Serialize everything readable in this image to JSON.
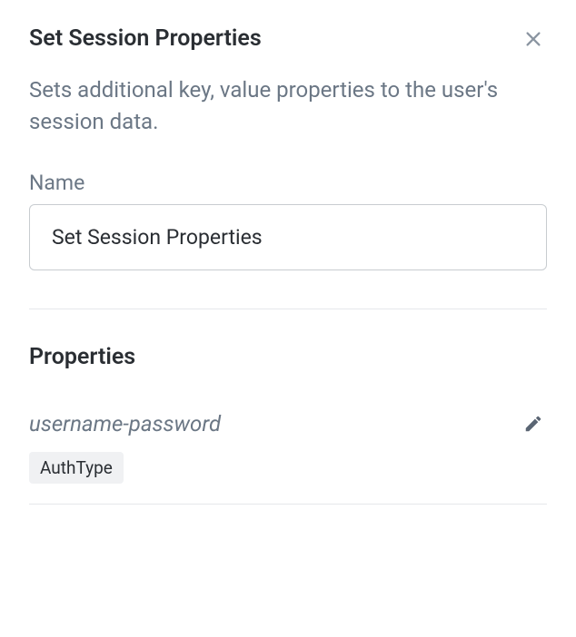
{
  "header": {
    "title": "Set Session Properties"
  },
  "description": "Sets additional key, value properties to the user's session data.",
  "name_field": {
    "label": "Name",
    "value": "Set Session Properties"
  },
  "properties_section": {
    "heading": "Properties",
    "items": [
      {
        "key": "username-password",
        "tag": "AuthType"
      }
    ]
  }
}
